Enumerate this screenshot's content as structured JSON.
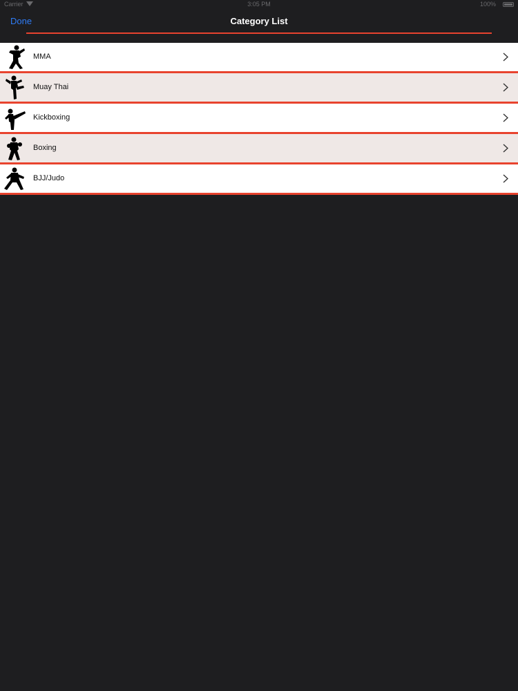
{
  "status_bar": {
    "carrier": "Carrier",
    "time": "3:05 PM",
    "battery": "100%"
  },
  "nav": {
    "done_label": "Done",
    "title": "Category List"
  },
  "categories": [
    {
      "label": "MMA",
      "icon": "mma-fighter-icon"
    },
    {
      "label": "Muay Thai",
      "icon": "muay-thai-fighter-icon"
    },
    {
      "label": "Kickboxing",
      "icon": "kickboxing-fighter-icon"
    },
    {
      "label": "Boxing",
      "icon": "boxer-icon"
    },
    {
      "label": "BJJ/Judo",
      "icon": "bjj-judo-fighter-icon"
    }
  ],
  "colors": {
    "background": "#1e1e20",
    "accent_red": "#e8432e",
    "link_blue": "#2f7cf6",
    "row_white": "#ffffff",
    "row_tint": "#efe8e6"
  }
}
